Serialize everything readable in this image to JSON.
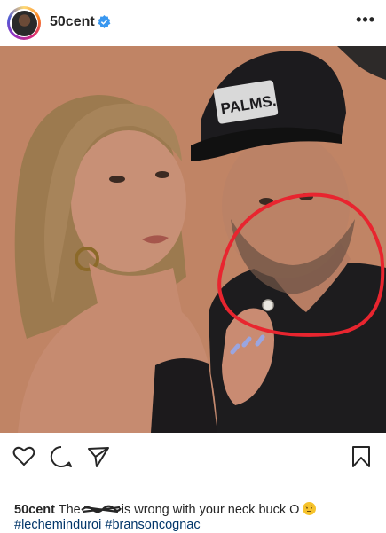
{
  "post": {
    "username": "50cent",
    "more_label": "•••"
  },
  "photo": {
    "cap_text": "PALMS."
  },
  "caption": {
    "username": "50cent",
    "text_before": "The",
    "text_after": "is wrong with your neck buck O",
    "hashtag_1": "#lecheminduroi",
    "hashtag_2": "#bransoncognac"
  },
  "icons": {
    "like": "heart-icon",
    "comment": "comment-icon",
    "share": "share-icon",
    "save": "bookmark-icon",
    "verified": "verified-badge-icon",
    "emoji": "raised-eyebrow-emoji"
  },
  "colors": {
    "annotation_circle": "#e8252f",
    "verified": "#3897f0",
    "hashtag": "#003569"
  }
}
